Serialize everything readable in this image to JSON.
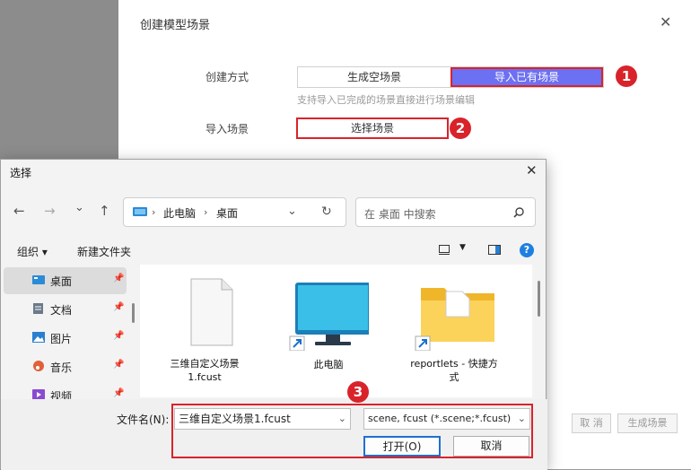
{
  "modal": {
    "title": "创建模型场景",
    "close_glyph": "✕",
    "create_mode_label": "创建方式",
    "mode_options": [
      "生成空场景",
      "导入已有场景"
    ],
    "selected_mode": "导入已有场景",
    "hint": "支持导入已完成的场景直接进行场景编辑",
    "import_label": "导入场景",
    "select_button": "选择场景",
    "cancel_button": "取 消",
    "generate_button": "生成场景"
  },
  "annotations": [
    "1",
    "2",
    "3"
  ],
  "dialog": {
    "title": "选择",
    "close_glyph": "✕",
    "nav": {
      "back": "←",
      "forward": "→",
      "recent": "⌄",
      "up": "↑"
    },
    "breadcrumb": [
      "此电脑",
      "桌面"
    ],
    "search_placeholder": "在 桌面 中搜索",
    "toolbar": {
      "organize": "组织 ▾",
      "new_folder": "新建文件夹"
    },
    "sidebar": [
      {
        "label": "桌面",
        "icon": "desktop-icon",
        "color": "#2a8bd6",
        "active": true
      },
      {
        "label": "文档",
        "icon": "document-icon",
        "color": "#6a7a8a",
        "active": false
      },
      {
        "label": "图片",
        "icon": "pictures-icon",
        "color": "#2a7fd0",
        "active": false
      },
      {
        "label": "音乐",
        "icon": "music-icon",
        "color": "#e0603a",
        "active": false
      },
      {
        "label": "视频",
        "icon": "video-icon",
        "color": "#8a4bd0",
        "active": false
      }
    ],
    "files": [
      {
        "name": "三维自定义场景1.fcust",
        "icon": "blank-file-icon"
      },
      {
        "name": "此电脑",
        "icon": "monitor-icon"
      },
      {
        "name": "reportlets - 快捷方式",
        "icon": "folder-shortcut-icon"
      }
    ],
    "filename_label": "文件名(N):",
    "filename_value": "三维自定义场景1.fcust",
    "filter_value": "scene, fcust (*.scene;*.fcust)",
    "open_button": "打开(O)",
    "cancel_button": "取消"
  },
  "colors": {
    "accent": "#6c70f2",
    "annotation_red": "#d9232b"
  }
}
